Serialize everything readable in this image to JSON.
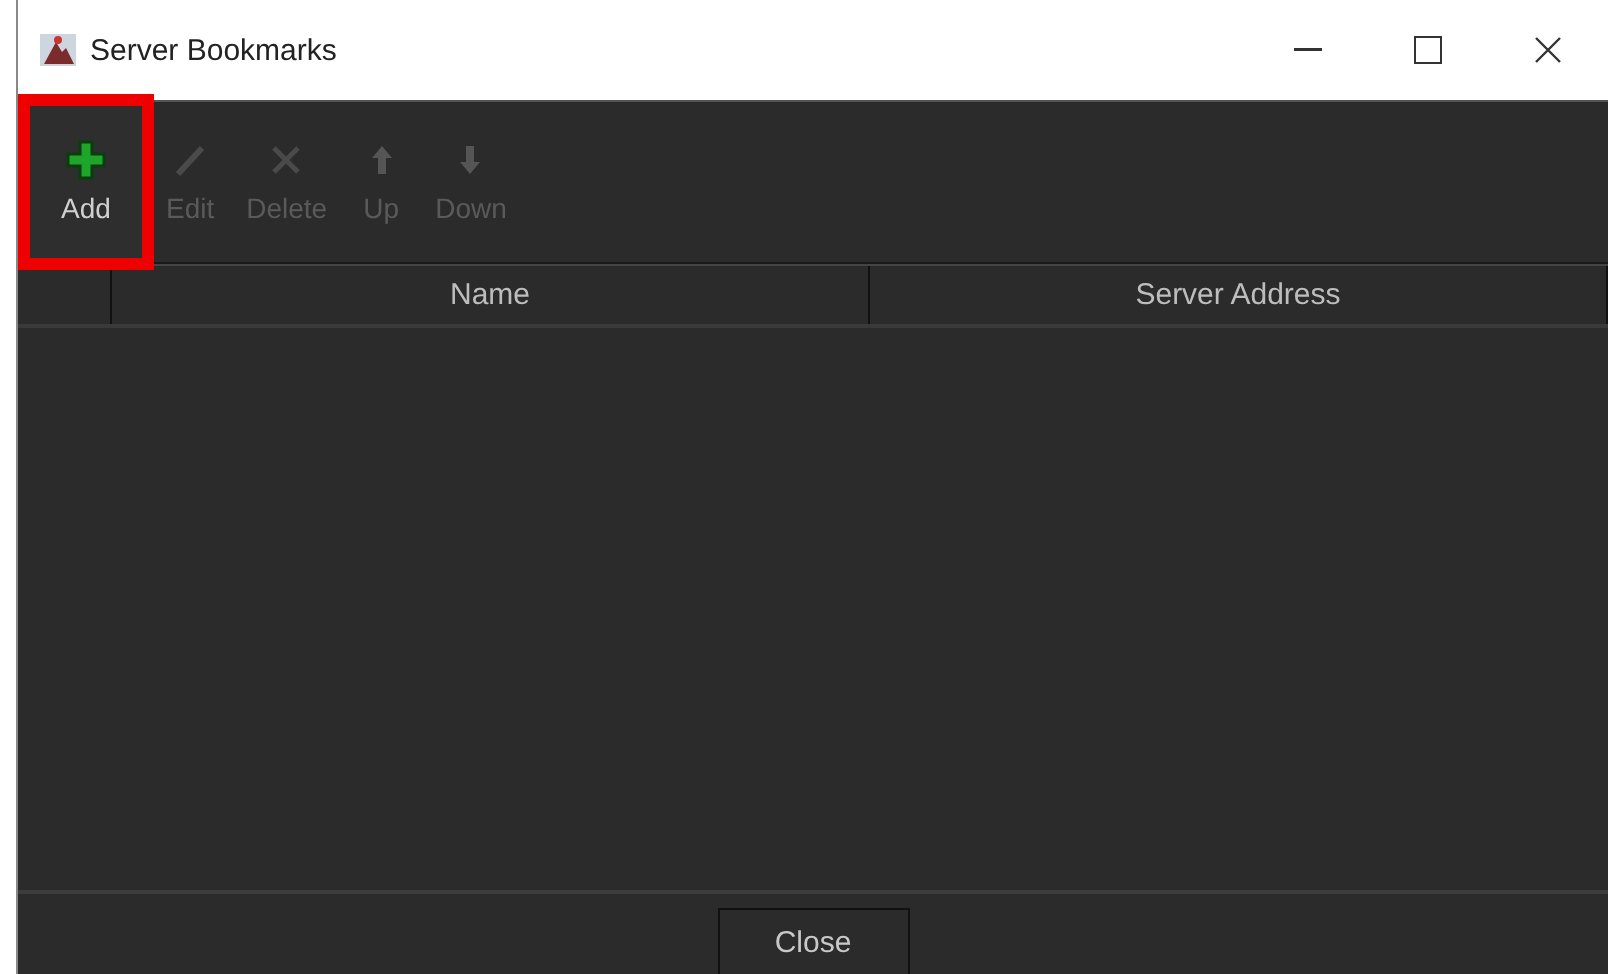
{
  "window": {
    "title": "Server Bookmarks"
  },
  "toolbar": [
    {
      "kind": "add",
      "label": "Add",
      "disabled": false,
      "highlighted": true
    },
    {
      "kind": "edit",
      "label": "Edit",
      "disabled": true,
      "highlighted": false
    },
    {
      "kind": "delete",
      "label": "Delete",
      "disabled": true,
      "highlighted": false
    },
    {
      "kind": "up",
      "label": "Up",
      "disabled": true,
      "highlighted": false
    },
    {
      "kind": "down",
      "label": "Down",
      "disabled": true,
      "highlighted": false
    }
  ],
  "table": {
    "columns": [
      "Name",
      "Server Address"
    ]
  },
  "buttons": [
    "Close"
  ]
}
